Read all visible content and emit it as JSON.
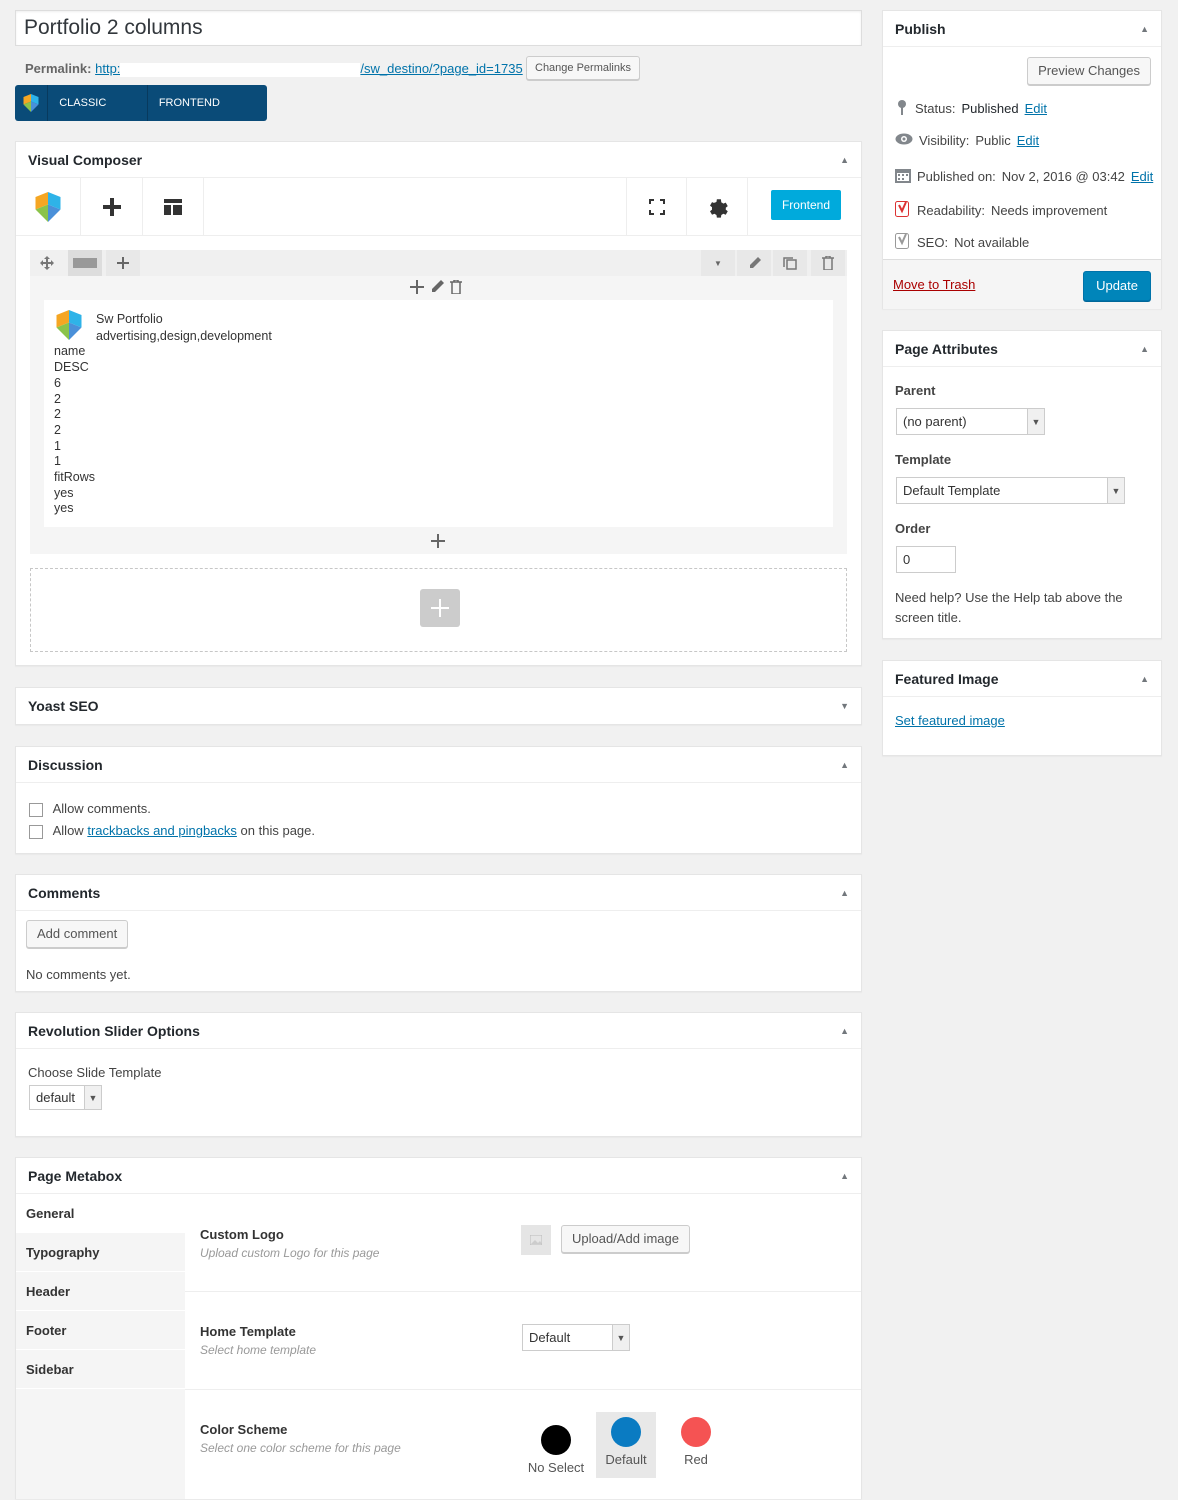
{
  "title": {
    "value": "Portfolio 2 columns"
  },
  "permalink": {
    "label": "Permalink:",
    "url_start": "http:",
    "url_end": "/sw_destino/?page_id=1735",
    "change_button": "Change Permalinks"
  },
  "vc_modes": {
    "classic": "CLASSIC MODE",
    "frontend": "FRONTEND EDITOR"
  },
  "visual_composer": {
    "heading": "Visual Composer",
    "frontend_button": "Frontend",
    "element": {
      "title": "Sw Portfolio",
      "subtitle": "advertising,design,development",
      "params": [
        "name",
        "DESC",
        "6",
        "2",
        "2",
        "2",
        "1",
        "1",
        "fitRows",
        "yes",
        "yes"
      ]
    }
  },
  "yoast": {
    "heading": "Yoast SEO"
  },
  "discussion": {
    "heading": "Discussion",
    "allow_comments": "Allow comments.",
    "allow_prefix": "Allow",
    "trackbacks_link": "trackbacks and pingbacks",
    "allow_suffix": "on this page."
  },
  "comments": {
    "heading": "Comments",
    "add_button": "Add comment",
    "empty": "No comments yet."
  },
  "revslider": {
    "heading": "Revolution Slider Options",
    "label": "Choose Slide Template",
    "value": "default"
  },
  "metabox": {
    "heading": "Page Metabox",
    "tabs": [
      "General",
      "Typography",
      "Header",
      "Footer",
      "Sidebar"
    ],
    "custom_logo": {
      "title": "Custom Logo",
      "desc": "Upload custom Logo for this page",
      "button": "Upload/Add image"
    },
    "home_template": {
      "title": "Home Template",
      "desc": "Select home template",
      "value": "Default"
    },
    "color_scheme": {
      "title": "Color Scheme",
      "desc": "Select one color scheme for this page",
      "options": [
        {
          "label": "No Select",
          "color": "#000000"
        },
        {
          "label": "Default",
          "color": "#0a7bc2"
        },
        {
          "label": "Red",
          "color": "#f55353"
        }
      ]
    }
  },
  "publish": {
    "heading": "Publish",
    "preview_button": "Preview Changes",
    "status_label": "Status:",
    "status_value": "Published",
    "visibility_label": "Visibility:",
    "visibility_value": "Public",
    "published_label": "Published on:",
    "published_value": "Nov 2, 2016 @ 03:42",
    "edit": "Edit",
    "readability_label": "Readability:",
    "readability_value": "Needs improvement",
    "seo_label": "SEO:",
    "seo_value": "Not available",
    "trash": "Move to Trash",
    "update_button": "Update"
  },
  "page_attributes": {
    "heading": "Page Attributes",
    "parent_label": "Parent",
    "parent_value": "(no parent)",
    "template_label": "Template",
    "template_value": "Default Template",
    "order_label": "Order",
    "order_value": "0",
    "help": "Need help? Use the Help tab above the screen title."
  },
  "featured_image": {
    "heading": "Featured Image",
    "link": "Set featured image"
  },
  "colors": {
    "primary": "#0085ba",
    "vc_blue": "#0a4b78",
    "vc_frontend": "#00aadc",
    "trash": "#a00"
  }
}
